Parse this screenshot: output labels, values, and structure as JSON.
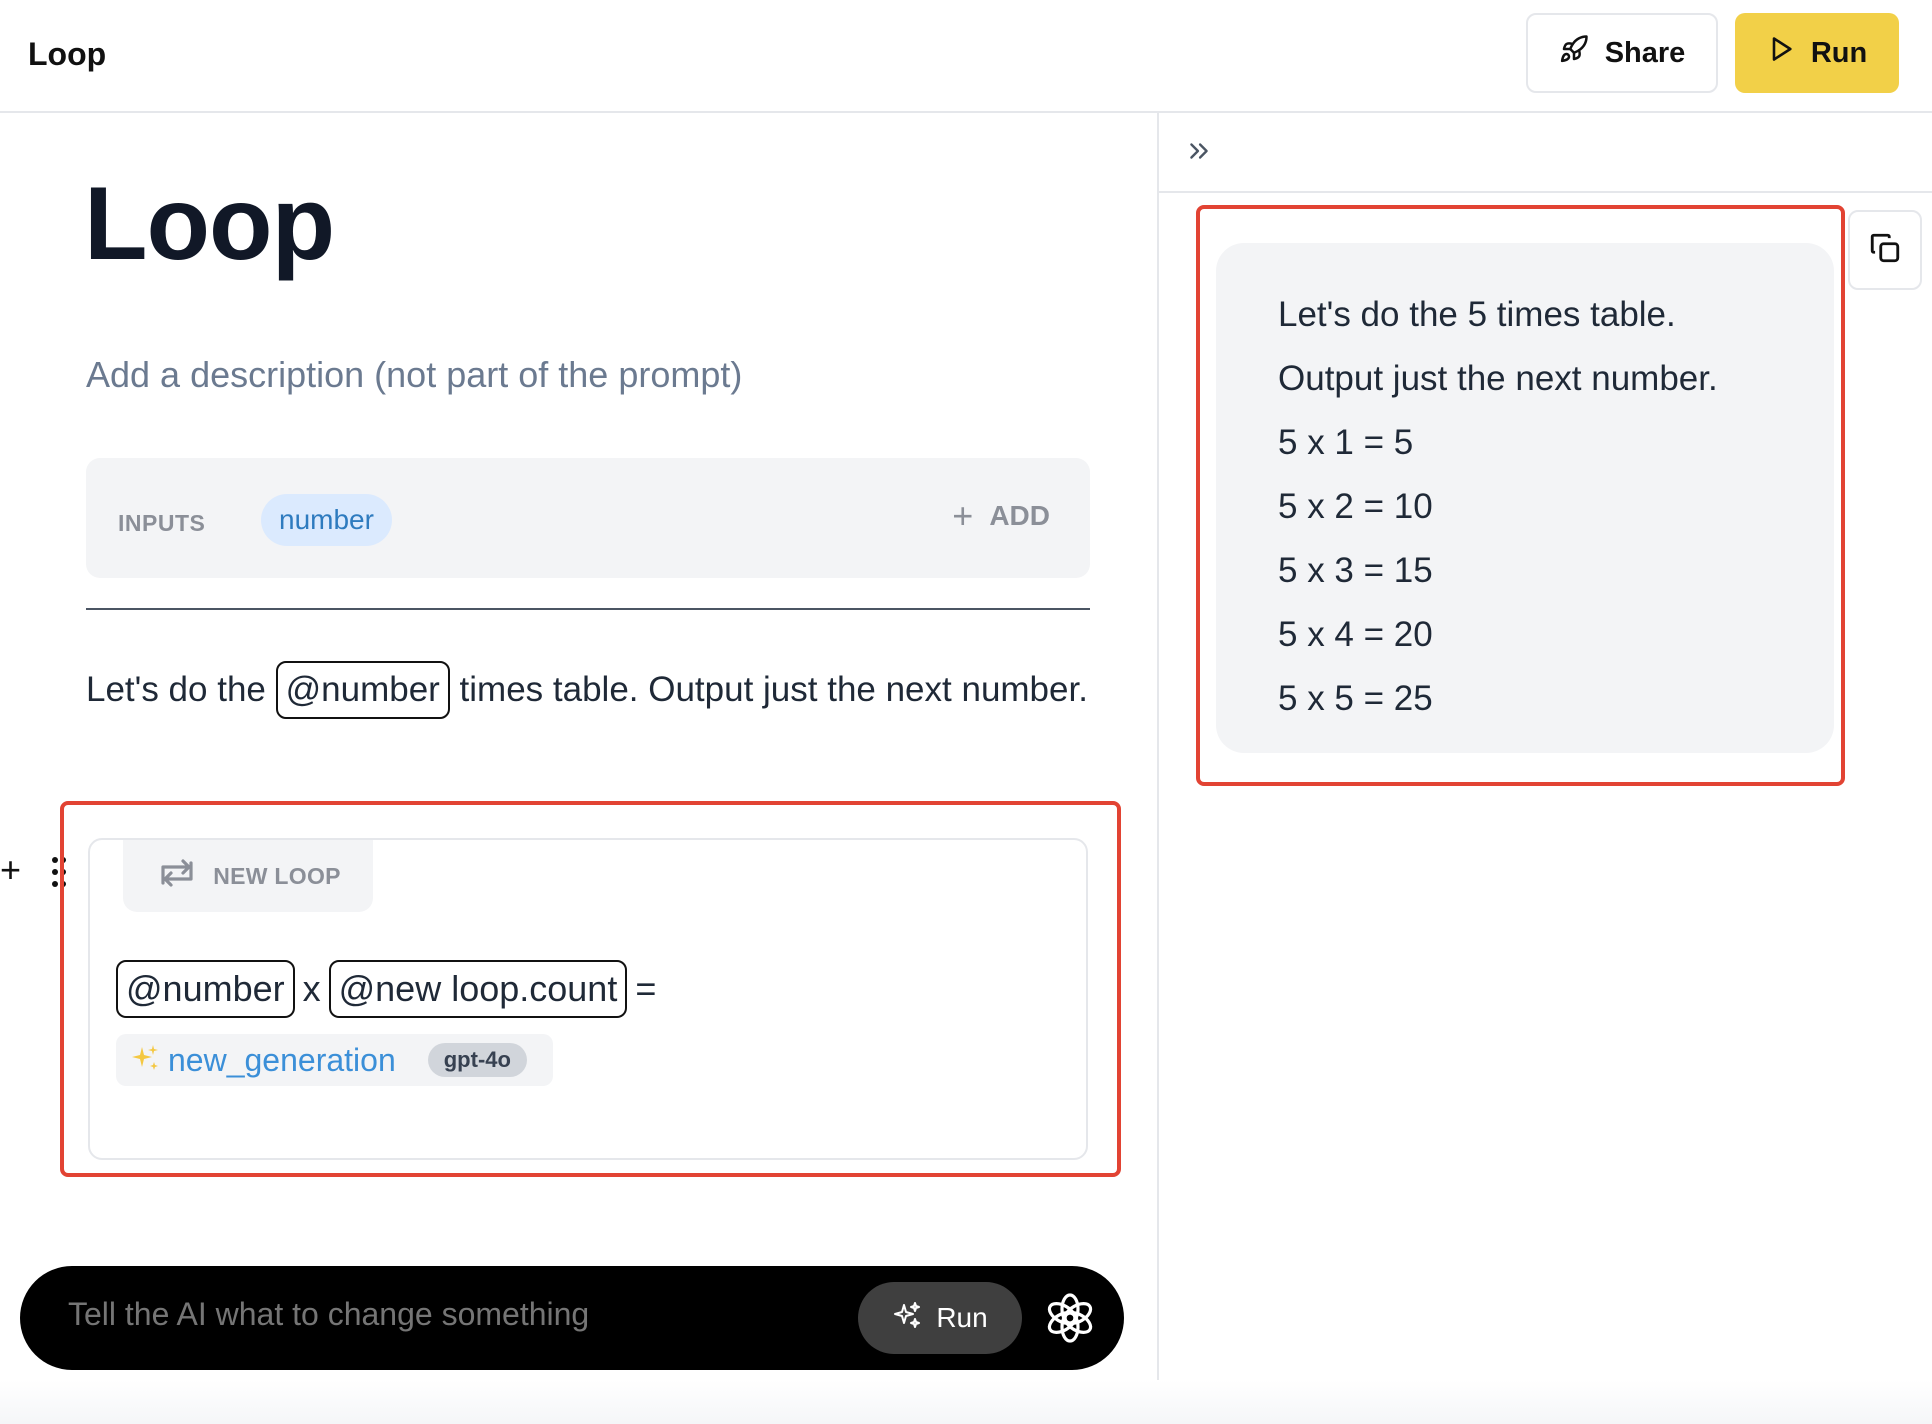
{
  "header": {
    "app_title": "Loop",
    "share_label": "Share",
    "run_label": "Run"
  },
  "page": {
    "title": "Loop",
    "description_placeholder": "Add a description (not part of the prompt)"
  },
  "inputs": {
    "label": "INPUTS",
    "items": [
      "number"
    ],
    "add_label": "ADD"
  },
  "prompt": {
    "before": "Let's do the",
    "mention": "@number",
    "after": "times table. Output just the next number."
  },
  "loop": {
    "badge_label": "NEW LOOP",
    "mention_a": "@number",
    "operator": "x",
    "mention_b": "@new loop.count",
    "equals": "=",
    "generation_name": "new_generation",
    "model": "gpt-4o"
  },
  "ai_bar": {
    "placeholder": "Tell the AI what to change something",
    "run_label": "Run"
  },
  "output": {
    "lines": [
      "Let's do the 5 times table.",
      "Output just the next number.",
      "5 x 1 = 5",
      "5 x 2 = 10",
      "5 x 3 = 15",
      "5 x 4 = 20",
      "5 x 5 = 25"
    ]
  },
  "colors": {
    "accent_yellow": "#f2d048",
    "highlight_red": "#e24333",
    "chip_blue": "#dbeafe",
    "link_blue": "#3b8fd8"
  },
  "icons": {
    "share": "rocket-icon",
    "run": "play-icon",
    "add": "plus-icon",
    "loop": "repeat-icon",
    "generation": "sparkles-icon",
    "ai_run": "sparkle-icon",
    "ai_logo": "openai-logo-icon",
    "expand": "chevrons-right-icon",
    "copy": "copy-icon",
    "drag": "drag-handle-icon"
  }
}
